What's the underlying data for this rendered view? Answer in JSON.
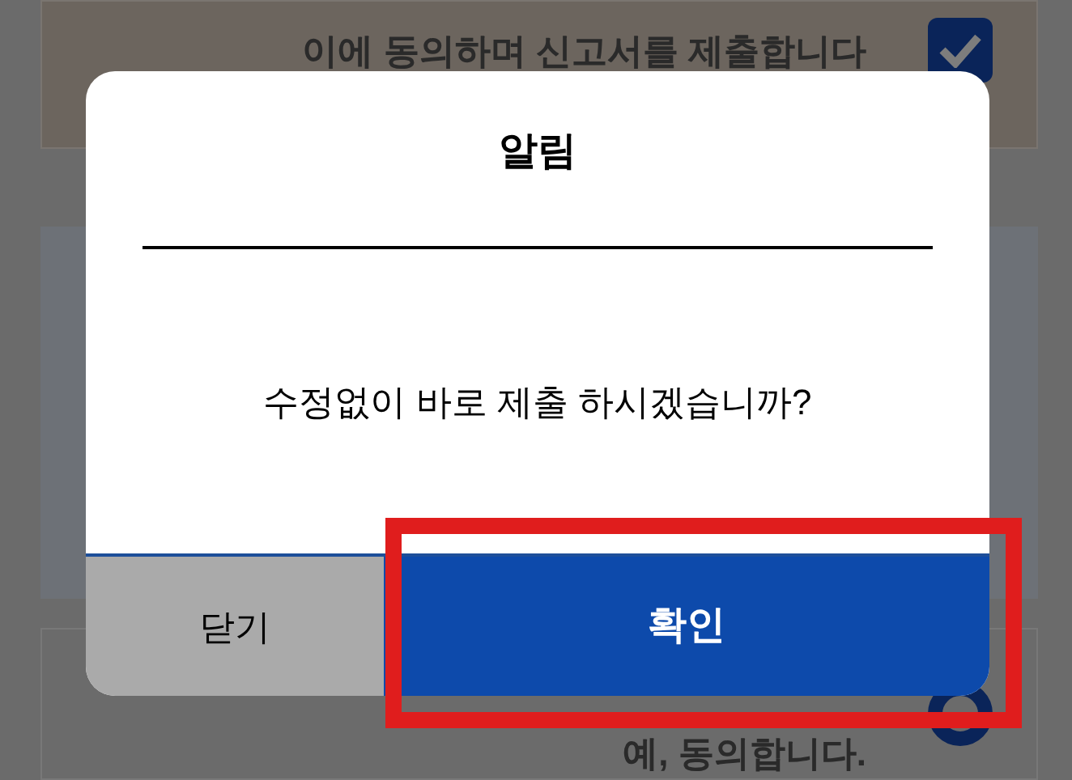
{
  "background": {
    "agree_submit": {
      "label": "이에 동의하며 신고서를 제출합니다",
      "checked": true
    },
    "agree_yes": {
      "label": "예, 동의합니다.",
      "selected": true
    }
  },
  "dialog": {
    "title": "알림",
    "message": "수정없이 바로 제출 하시겠습니까?",
    "buttons": [
      {
        "label": "닫기",
        "kind": "secondary"
      },
      {
        "label": "확인",
        "kind": "primary",
        "highlighted": true
      }
    ]
  }
}
